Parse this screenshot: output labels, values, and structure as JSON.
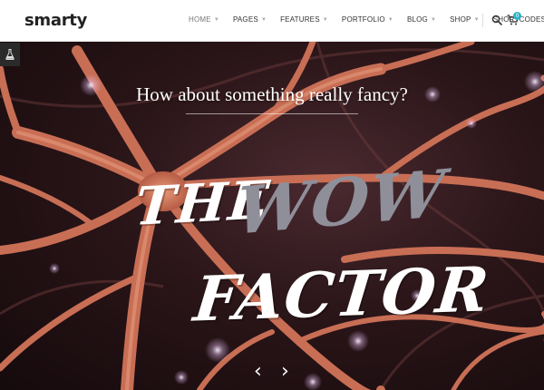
{
  "header": {
    "logo": "smarty",
    "nav": [
      {
        "label": "HOME",
        "active": true
      },
      {
        "label": "PAGES"
      },
      {
        "label": "FEATURES"
      },
      {
        "label": "PORTFOLIO"
      },
      {
        "label": "BLOG"
      },
      {
        "label": "SHOP"
      },
      {
        "label": "SHORTCODES"
      }
    ],
    "cart_count": "0",
    "icons": {
      "search": "search-icon",
      "cart": "cart-icon",
      "side_tab": "flask-icon"
    }
  },
  "hero": {
    "heading": "How about something really fancy?",
    "line1": "THE",
    "line2": "WOW",
    "line3": "FACTOR",
    "prev": "‹",
    "next": "›"
  },
  "colors": {
    "accent": "#2ab3c7",
    "wow_gray": "#8f8f9a",
    "neuron": "#c86e55"
  }
}
